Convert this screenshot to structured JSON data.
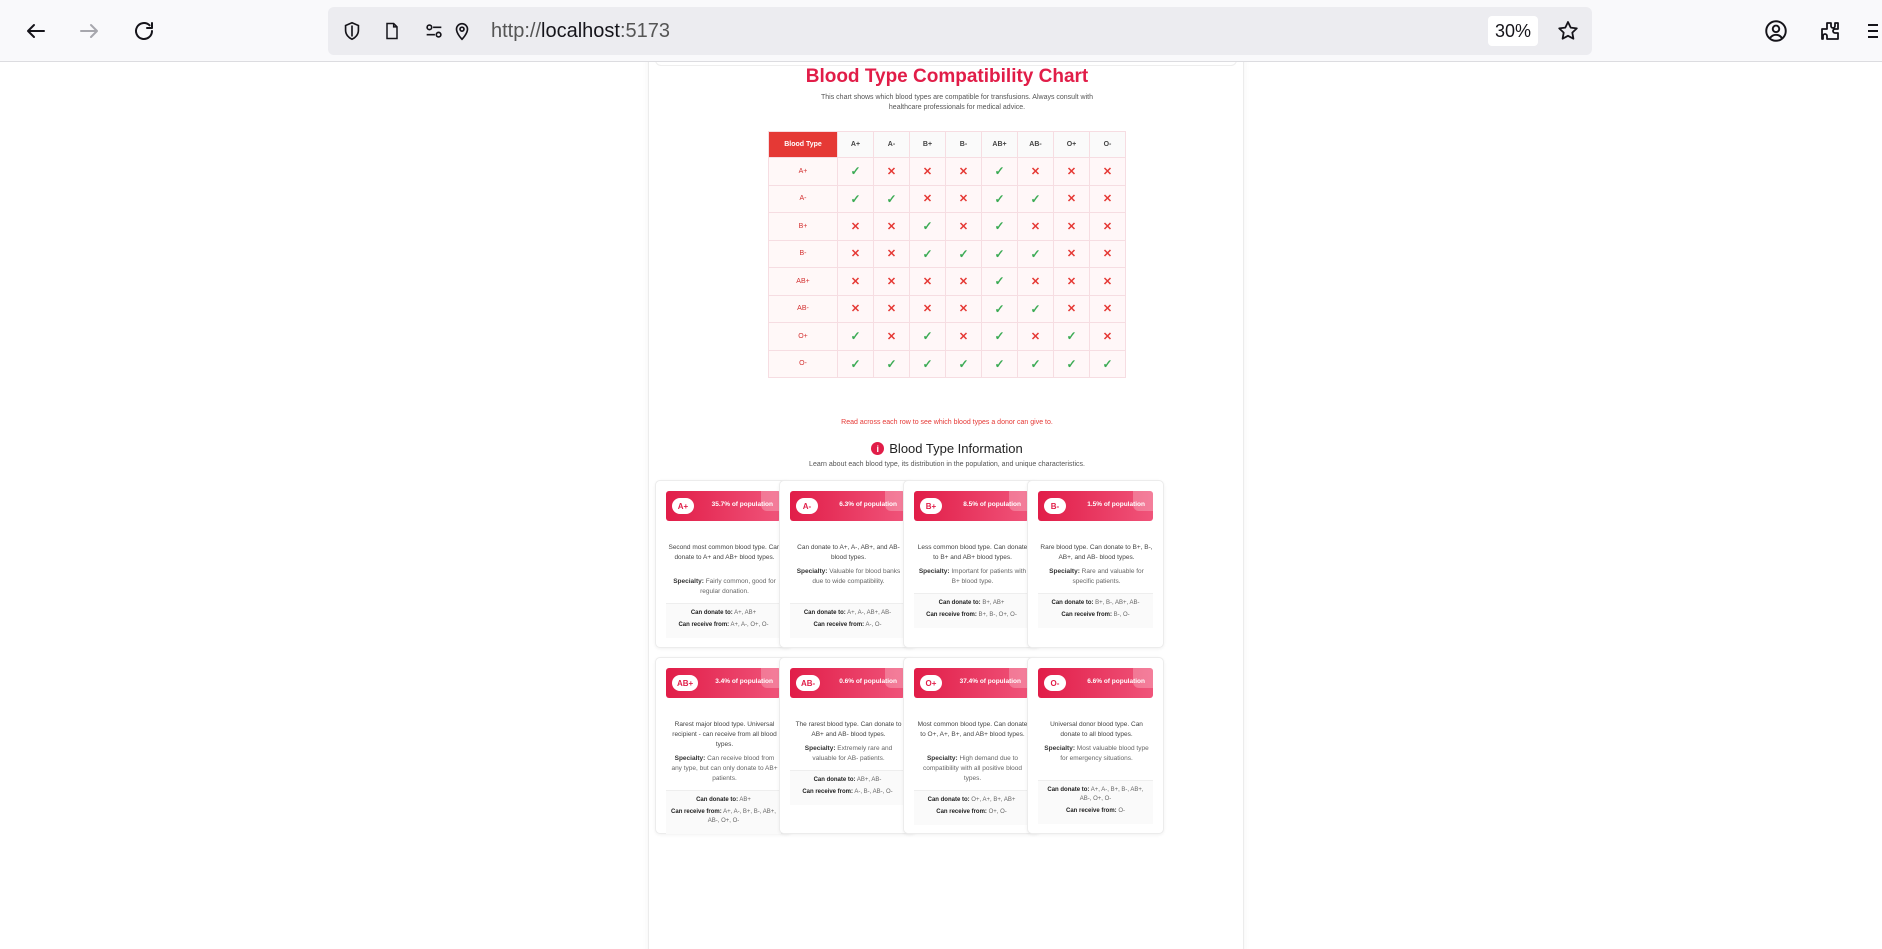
{
  "browser": {
    "url_prefix": "http://",
    "url_host": "localhost",
    "url_port": ":5173",
    "zoom": "30%"
  },
  "chart": {
    "title": "Blood Type Compatibility Chart",
    "description": "This chart shows which blood types are compatible for transfusions. Always consult with healthcare professionals for medical advice.",
    "corner_label": "Blood Type",
    "columns": [
      "A+",
      "A-",
      "B+",
      "B-",
      "AB+",
      "AB-",
      "O+",
      "O-"
    ],
    "rows": [
      {
        "type": "A+",
        "marks": [
          1,
          0,
          0,
          0,
          1,
          0,
          0,
          0
        ]
      },
      {
        "type": "A-",
        "marks": [
          1,
          1,
          0,
          0,
          1,
          1,
          0,
          0
        ]
      },
      {
        "type": "B+",
        "marks": [
          0,
          0,
          1,
          0,
          1,
          0,
          0,
          0
        ]
      },
      {
        "type": "B-",
        "marks": [
          0,
          0,
          1,
          1,
          1,
          1,
          0,
          0
        ]
      },
      {
        "type": "AB+",
        "marks": [
          0,
          0,
          0,
          0,
          1,
          0,
          0,
          0
        ]
      },
      {
        "type": "AB-",
        "marks": [
          0,
          0,
          0,
          0,
          1,
          1,
          0,
          0
        ]
      },
      {
        "type": "O+",
        "marks": [
          1,
          0,
          1,
          0,
          1,
          0,
          1,
          0
        ]
      },
      {
        "type": "O-",
        "marks": [
          1,
          1,
          1,
          1,
          1,
          1,
          1,
          1
        ]
      }
    ],
    "yes_glyph": "✓",
    "no_glyph": "✕",
    "hint": "Read across each row to see which blood types a donor can give to."
  },
  "info": {
    "title": "Blood Type Information",
    "icon": "i",
    "subtitle": "Learn about each blood type, its distribution in the population, and unique characteristics."
  },
  "labels": {
    "specialty": "Specialty:",
    "donate": "Can donate to:",
    "receive": "Can receive from:"
  },
  "cards": [
    {
      "type": "A+",
      "population": "35.7% of population",
      "desc": "Second most common blood type. Can donate to A+ and AB+ blood types.",
      "specialty": "Fairly common, good for regular donation.",
      "donate": "A+, AB+",
      "receive": "A+, A-, O+, O-"
    },
    {
      "type": "A-",
      "population": "6.3% of population",
      "desc": "Can donate to A+, A-, AB+, and AB- blood types.",
      "specialty": "Valuable for blood banks due to wide compatibility.",
      "donate": "A+, A-, AB+, AB-",
      "receive": "A-, O-"
    },
    {
      "type": "B+",
      "population": "8.5% of population",
      "desc": "Less common blood type. Can donate to B+ and AB+ blood types.",
      "specialty": "Important for patients with B+ blood type.",
      "donate": "B+, AB+",
      "receive": "B+, B-, O+, O-"
    },
    {
      "type": "B-",
      "population": "1.5% of population",
      "desc": "Rare blood type. Can donate to B+, B-, AB+, and AB- blood types.",
      "specialty": "Rare and valuable for specific patients.",
      "donate": "B+, B-, AB+, AB-",
      "receive": "B-, O-"
    },
    {
      "type": "AB+",
      "population": "3.4% of population",
      "desc": "Rarest major blood type. Universal recipient - can receive from all blood types.",
      "specialty": "Can receive blood from any type, but can only donate to AB+ patients.",
      "donate": "AB+",
      "receive": "A+, A-, B+, B-, AB+, AB-, O+, O-"
    },
    {
      "type": "AB-",
      "population": "0.6% of population",
      "desc": "The rarest blood type. Can donate to AB+ and AB- blood types.",
      "specialty": "Extremely rare and valuable for AB- patients.",
      "donate": "AB+, AB-",
      "receive": "A-, B-, AB-, O-"
    },
    {
      "type": "O+",
      "population": "37.4% of population",
      "desc": "Most common blood type. Can donate to O+, A+, B+, and AB+ blood types.",
      "specialty": "High demand due to compatibility with all positive blood types.",
      "donate": "O+, A+, B+, AB+",
      "receive": "O+, O-"
    },
    {
      "type": "O-",
      "population": "6.6% of population",
      "desc": "Universal donor blood type. Can donate to all blood types.",
      "specialty": "Most valuable blood type for emergency situations.",
      "donate": "A+, A-, B+, B-, AB+, AB-, O+, O-",
      "receive": "O-"
    }
  ]
}
